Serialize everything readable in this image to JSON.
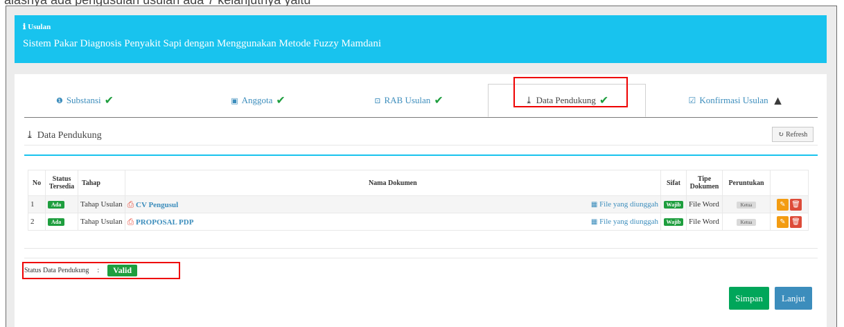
{
  "top_clipped_text": "alasnya ada pengusulan usulan ada 7 kelanjutnya yaitu",
  "info": {
    "label": "Usulan",
    "title": "Sistem Pakar Diagnosis Penyakit Sapi dengan Menggunakan Metode Fuzzy Mamdani"
  },
  "tabs": [
    {
      "label": "Substansi"
    },
    {
      "label": "Anggota"
    },
    {
      "label": "RAB Usulan"
    },
    {
      "label": "Data Pendukung"
    },
    {
      "label": "Konfirmasi Usulan"
    }
  ],
  "section": {
    "title": "Data Pendukung",
    "refresh_label": "Refresh"
  },
  "table": {
    "headers": {
      "no": "No",
      "status1": "Status",
      "status2": "Tersedia",
      "tahap": "Tahap",
      "nama": "Nama Dokumen",
      "sifat": "Sifat",
      "tipe1": "Tipe",
      "tipe2": "Dokumen",
      "peruntukan": "Peruntukan"
    },
    "rows": [
      {
        "no": "1",
        "status": "Ada",
        "tahap": "Tahap Usulan",
        "nama": "CV Pengusul",
        "file": "File yang diunggah",
        "sifat": "Wajib",
        "tipe": "File Word",
        "peruntukan": "Ketua"
      },
      {
        "no": "2",
        "status": "Ada",
        "tahap": "Tahap Usulan",
        "nama": "PROPOSAL PDP",
        "file": "File yang diunggah",
        "sifat": "Wajib",
        "tipe": "File Word",
        "peruntukan": "Ketua"
      }
    ]
  },
  "status": {
    "label": "Status Data Pendukung",
    "sep": ":",
    "value": "Valid"
  },
  "buttons": {
    "simpan": "Simpan",
    "lanjut": "Lanjut"
  },
  "colors": {
    "header_bg": "#18c3ee",
    "success": "#1e9e3e",
    "primary": "#3c8dbc",
    "warning": "#f39c12",
    "danger": "#dd4b39",
    "highlight": "#e00000"
  }
}
